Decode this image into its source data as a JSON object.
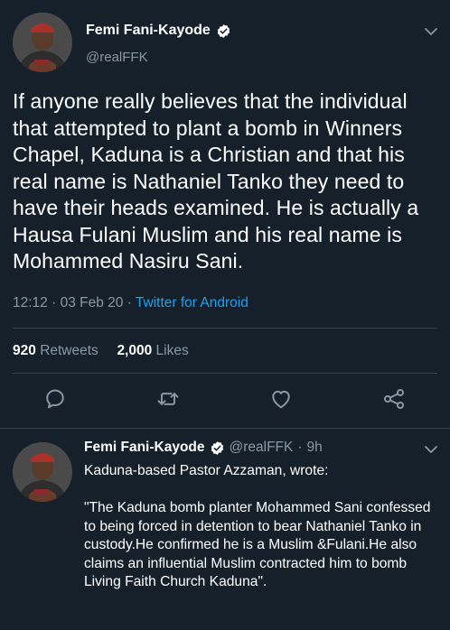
{
  "main_tweet": {
    "author_name": "Femi Fani-Kayode",
    "author_handle": "@realFFK",
    "text": "If anyone really believes that the individual that attempted to plant a bomb in Winners Chapel, Kaduna is a Christian and that his real name is Nathaniel Tanko they need to have their heads examined. He is actually a Hausa Fulani Muslim and his real name is Mohammed Nasiru Sani.",
    "time": "12:12",
    "date": "03 Feb 20",
    "source": "Twitter for Android",
    "retweets_count": "920",
    "retweets_label": "Retweets",
    "likes_count": "2,000",
    "likes_label": "Likes"
  },
  "reply_tweet": {
    "author_name": "Femi Fani-Kayode",
    "author_handle": "@realFFK",
    "age": "9h",
    "line1": "Kaduna-based Pastor Azzaman, wrote:",
    "quote": "\"The Kaduna bomb planter Mohammed Sani confessed to being forced in detention to bear Nathaniel Tanko in custody.He confirmed he is a Muslim &Fulani.He also claims an influential Muslim contracted him to bomb Living Faith Church Kaduna\"."
  },
  "separator": "·",
  "colors": {
    "background": "#15202b",
    "text_primary": "#ffffff",
    "text_secondary": "#8899a6",
    "accent": "#1da1f2",
    "divider": "#38444d"
  },
  "icons": [
    "verified-badge-icon",
    "chevron-down-icon",
    "reply-icon",
    "retweet-icon",
    "like-icon",
    "share-icon"
  ]
}
